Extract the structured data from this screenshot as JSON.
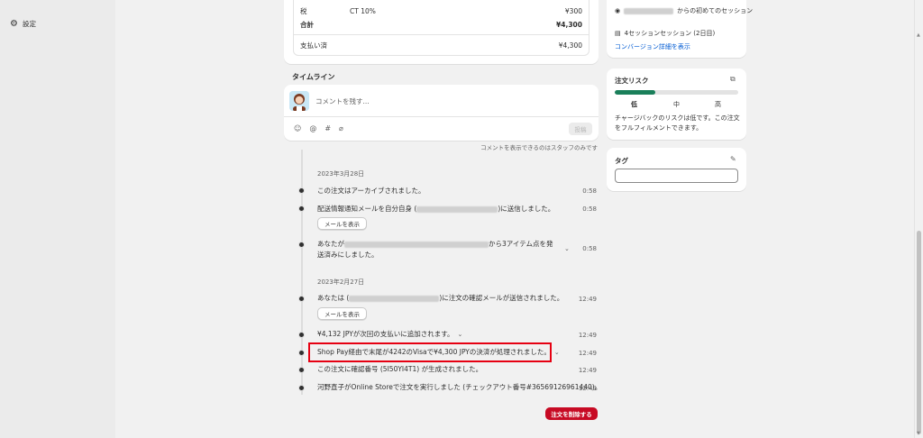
{
  "sidebar": {
    "settings_label": "設定"
  },
  "summary": {
    "tax_label": "税",
    "tax_detail": "CT 10%",
    "tax_amount": "¥300",
    "total_label": "合計",
    "total_amount": "¥4,300",
    "paid_label": "支払い済",
    "paid_amount": "¥4,300"
  },
  "timeline": {
    "heading": "タイムライン",
    "comment_placeholder": "コメントを残す...",
    "post_label": "投稿",
    "staff_note": "コメントを表示できるのはスタッフのみです",
    "mail_button": "メールを表示",
    "groups": [
      {
        "date": "2023年3月28日",
        "events": [
          {
            "text": "この注文はアーカイブされました。",
            "time": "0:58"
          },
          {
            "text_prefix": "配送情報通知メールを自分自身 (",
            "text_suffix": ")に送信しました。",
            "time": "0:58"
          },
          {
            "text_prefix": "あなたが",
            "text_mid": "から3アイテム点を発",
            "text_line2": "送済みにしました。",
            "time": "0:58"
          }
        ]
      },
      {
        "date": "2023年2月27日",
        "events": [
          {
            "text_prefix": "あなたは (",
            "text_suffix": ")に注文の確認メールが送信されました。",
            "time": "12:49"
          },
          {
            "text": "¥4,132 JPYが次回の支払いに追加されます。",
            "time": "12:49"
          },
          {
            "text": "Shop Pay経由で末尾が4242のVisaで¥4,300 JPYの決済が処理されました。",
            "time": "12:49"
          },
          {
            "text": "この注文に確認番号 (5I50YI4T1) が生成されました。",
            "time": "12:49"
          },
          {
            "text": "河野直子がOnline Storeで注文を実行しました (チェックアウト番号#36569126961440)。",
            "time": "12:49"
          }
        ]
      }
    ],
    "delete_label": "注文を削除する"
  },
  "right_panel": {
    "session_first": "からの初めてのセッション",
    "session_count": "4セッションセッション (2日目)",
    "conversion_link": "コンバージョン詳細を表示",
    "risk": {
      "title": "注文リスク",
      "level": 0.33,
      "low": "低",
      "mid": "中",
      "high": "高",
      "description": "チャージバックのリスクは低です。この注文をフルフィルメントできます。"
    },
    "tags": {
      "title": "タグ"
    }
  },
  "colors": {
    "accent_green": "#1a7f5a",
    "danger": "#c70a24",
    "highlight": "#e60012",
    "link": "#005bd3"
  }
}
